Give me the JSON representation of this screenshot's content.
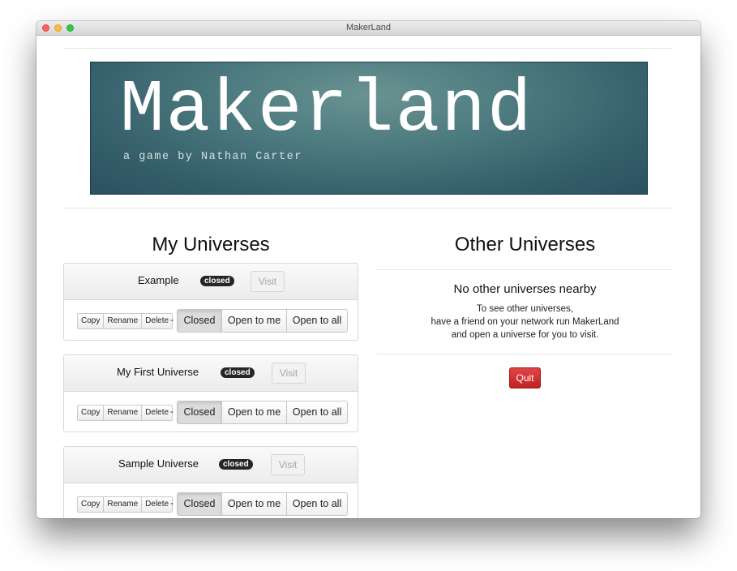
{
  "window": {
    "title": "MakerLand"
  },
  "banner": {
    "title": "Makerland",
    "subtitle": "a game by Nathan Carter"
  },
  "my_universes": {
    "heading": "My Universes",
    "universes": [
      {
        "name": "Example",
        "status": "closed",
        "visit_label": "Visit",
        "actions": [
          "Copy",
          "Rename",
          "Delete"
        ],
        "separator": "-",
        "access_options": [
          "Closed",
          "Open to me",
          "Open to all"
        ],
        "selected_access": "Closed"
      },
      {
        "name": "My First Universe",
        "status": "closed",
        "visit_label": "Visit",
        "actions": [
          "Copy",
          "Rename",
          "Delete"
        ],
        "separator": "-",
        "access_options": [
          "Closed",
          "Open to me",
          "Open to all"
        ],
        "selected_access": "Closed"
      },
      {
        "name": "Sample Universe",
        "status": "closed",
        "visit_label": "Visit",
        "actions": [
          "Copy",
          "Rename",
          "Delete"
        ],
        "separator": "-",
        "access_options": [
          "Closed",
          "Open to me",
          "Open to all"
        ],
        "selected_access": "Closed"
      }
    ]
  },
  "other_universes": {
    "heading": "Other Universes",
    "empty_title": "No other universes nearby",
    "empty_lines": [
      "To see other universes,",
      "have a friend on your network run MakerLand",
      "and open a universe for you to visit."
    ],
    "quit_label": "Quit"
  },
  "colors": {
    "banner_bg": "#4e7c80",
    "quit_button": "#d03030",
    "badge": "#262626"
  }
}
